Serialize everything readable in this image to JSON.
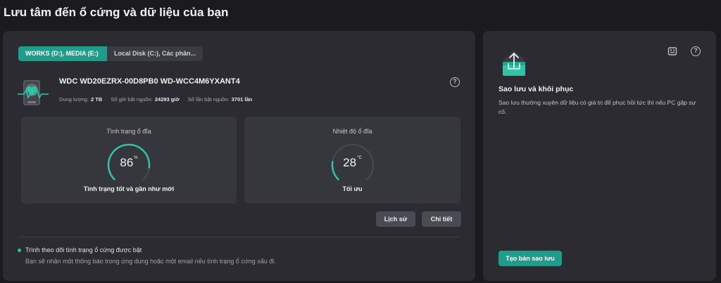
{
  "page": {
    "title": "Lưu tâm đến ổ cứng và dữ liệu của bạn"
  },
  "colors": {
    "accent": "#1f9d8a",
    "gauge_track": "#3f4a4a",
    "gauge_fill": "#2ec4a6"
  },
  "drive_tabs": [
    {
      "label": "WORKS (D:), MEDIA (E:)",
      "active": true
    },
    {
      "label": "Local Disk (C:), Các phân...",
      "active": false
    }
  ],
  "disk": {
    "icon": "hard-drive-health-icon",
    "name": "WDC WD20EZRX-00D8PB0 WD-WCC4M6YXANT4",
    "capacity_label": "Dung lượng:",
    "capacity_value": "2 TB",
    "power_hours_label": "Số giờ bật nguồn:",
    "power_hours_value": "24293 giờ",
    "power_count_label": "Số lần bật nguồn:",
    "power_count_value": "3701 lần"
  },
  "health": {
    "title": "Tình trạng ổ đĩa",
    "value": "86",
    "unit": "%",
    "percent": 86,
    "status": "Tình trạng tốt và gần như mới"
  },
  "temperature": {
    "title": "Nhiệt độ ổ đĩa",
    "value": "28",
    "unit": "°C",
    "level": 0.2,
    "status": "Tối ưu"
  },
  "buttons": {
    "history": "Lịch sử",
    "detail": "Chi tiết"
  },
  "monitoring": {
    "title": "Trình theo dõi tình trạng ổ cứng được bật",
    "description": "Bạn sẽ nhận một thông báo trong ứng dụng hoặc một email nếu tình trạng ổ cứng xấu đi."
  },
  "backup": {
    "icon": "backup-upload-icon",
    "title": "Sao lưu và khôi phục",
    "description": "Sao lưu thường xuyên dữ liệu có giá trị để phục hồi tức thì nếu PC gặp sự cố.",
    "button": "Tạo bản sao lưu"
  }
}
